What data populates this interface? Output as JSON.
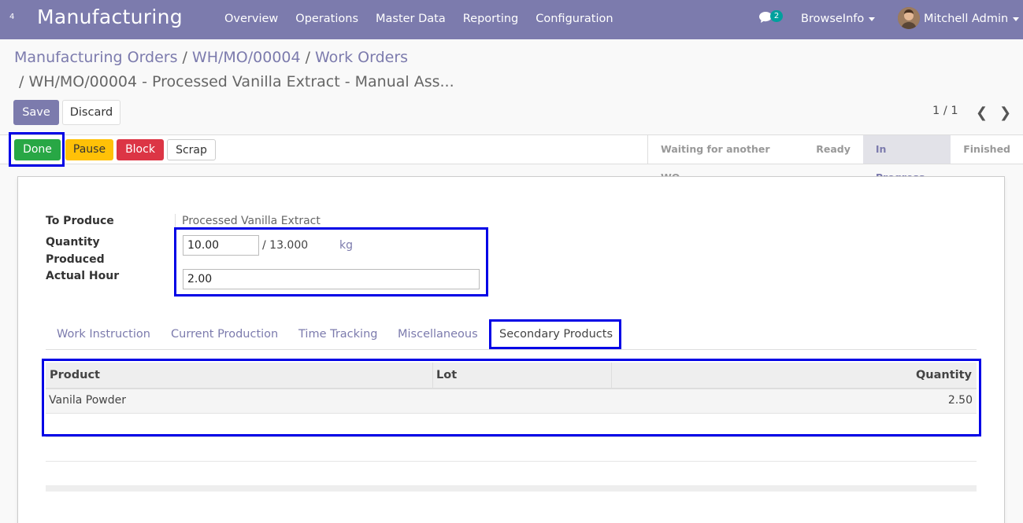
{
  "navbar": {
    "small_number": "4",
    "app_title": "Manufacturing",
    "menu": [
      "Overview",
      "Operations",
      "Master Data",
      "Reporting",
      "Configuration"
    ],
    "chat_count": "2",
    "company": "BrowseInfo",
    "user": "Mitchell Admin"
  },
  "breadcrumb": {
    "items": [
      "Manufacturing Orders",
      "WH/MO/00004",
      "Work Orders"
    ],
    "separator": "/",
    "current": "/ WH/MO/00004 - Processed Vanilla Extract - Manual Ass..."
  },
  "buttons": {
    "save": "Save",
    "discard": "Discard"
  },
  "pager": {
    "value": "1 / 1",
    "prev": "‹",
    "next": "›"
  },
  "statusbar": {
    "buttons": {
      "done": "Done",
      "pause": "Pause",
      "block": "Block",
      "scrap": "Scrap"
    },
    "stages": [
      "Waiting for another WO",
      "Ready",
      "In Progress",
      "Finished"
    ],
    "active_stage": "In Progress"
  },
  "form": {
    "to_produce_label": "To Produce",
    "to_produce_value": "Processed Vanilla Extract",
    "qty_label_1": "Quantity",
    "qty_label_2": "Produced",
    "qty_value": "10.00",
    "qty_slash": "/",
    "qty_total": "13.000",
    "uom": "kg",
    "hour_label": "Actual Hour",
    "hour_value": "2.00"
  },
  "tabs": [
    "Work Instruction",
    "Current Production",
    "Time Tracking",
    "Miscellaneous",
    "Secondary Products"
  ],
  "active_tab": "Secondary Products",
  "table": {
    "headers": {
      "product": "Product",
      "lot": "Lot",
      "quantity": "Quantity"
    },
    "rows": [
      {
        "product": "Vanila Powder",
        "lot": "",
        "quantity": "2.50"
      }
    ]
  },
  "colors": {
    "brand": "#7c7bad",
    "done": "#28a745",
    "pause": "#ffc107",
    "block": "#dc3545",
    "highlight": "#0000e6"
  }
}
